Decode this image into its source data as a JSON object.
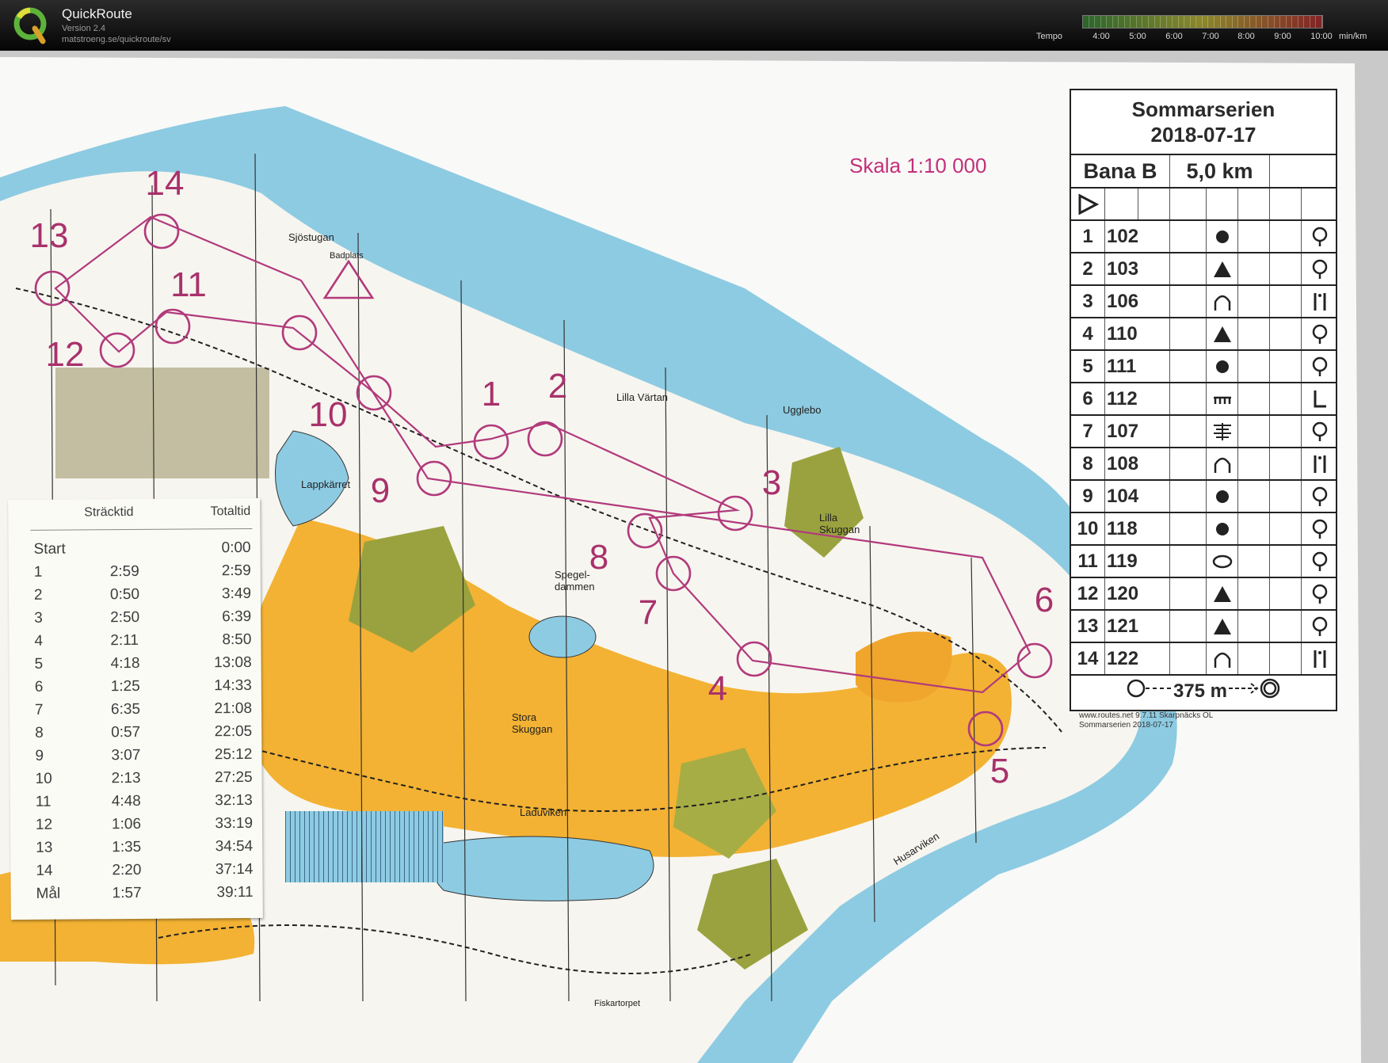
{
  "header": {
    "app_name": "QuickRoute",
    "version": "Version 2.4",
    "url": "matstroeng.se/quickroute/sv",
    "tempo_label": "Tempo",
    "tempo_ticks": [
      "4:00",
      "5:00",
      "6:00",
      "7:00",
      "8:00",
      "9:00",
      "10:00"
    ],
    "tempo_unit": "min/km",
    "tempo_colors": [
      "#3fa43a",
      "#e9e23a",
      "#d92f2f"
    ]
  },
  "map": {
    "scale": "Skala 1:10 000",
    "places": [
      "Sjöstugan",
      "Badplats",
      "Lilla Värtan",
      "Ugglebo",
      "Lappkärret",
      "Lilla Skuggan",
      "Spegel-dammen",
      "Stora Skuggan",
      "Laduviken",
      "Husarviken",
      "Fiskartorpet"
    ],
    "control_numbers": [
      "1",
      "2",
      "3",
      "4",
      "5",
      "6",
      "7",
      "8",
      "9",
      "10",
      "11",
      "12",
      "13",
      "14"
    ],
    "colors": {
      "water": "#86c9e0",
      "forest": "#f8f6f2",
      "open": "#f3b233",
      "green": "#9aa23f",
      "course": "#b13a7c"
    }
  },
  "splits": {
    "headers": {
      "leg": "Sträcktid",
      "total": "Totaltid"
    },
    "rows": [
      {
        "label": "Start",
        "leg": "",
        "total": "0:00"
      },
      {
        "label": "1",
        "leg": "2:59",
        "total": "2:59"
      },
      {
        "label": "2",
        "leg": "0:50",
        "total": "3:49"
      },
      {
        "label": "3",
        "leg": "2:50",
        "total": "6:39"
      },
      {
        "label": "4",
        "leg": "2:11",
        "total": "8:50"
      },
      {
        "label": "5",
        "leg": "4:18",
        "total": "13:08"
      },
      {
        "label": "6",
        "leg": "1:25",
        "total": "14:33"
      },
      {
        "label": "7",
        "leg": "6:35",
        "total": "21:08"
      },
      {
        "label": "8",
        "leg": "0:57",
        "total": "22:05"
      },
      {
        "label": "9",
        "leg": "3:07",
        "total": "25:12"
      },
      {
        "label": "10",
        "leg": "2:13",
        "total": "27:25"
      },
      {
        "label": "11",
        "leg": "4:48",
        "total": "32:13"
      },
      {
        "label": "12",
        "leg": "1:06",
        "total": "33:19"
      },
      {
        "label": "13",
        "leg": "1:35",
        "total": "34:54"
      },
      {
        "label": "14",
        "leg": "2:20",
        "total": "37:14"
      },
      {
        "label": "Mål",
        "leg": "1:57",
        "total": "39:11"
      }
    ]
  },
  "control_sheet": {
    "title_line1": "Sommarserien",
    "title_line2": "2018-07-17",
    "course": "Bana B",
    "length": "5,0 km",
    "controls": [
      {
        "num": "1",
        "code": "102",
        "feature": "dot-icon",
        "detail": "knoll-icon"
      },
      {
        "num": "2",
        "code": "103",
        "feature": "triangle-icon",
        "detail": "knoll-icon"
      },
      {
        "num": "3",
        "code": "106",
        "feature": "cliff-icon",
        "detail": "bar-icon"
      },
      {
        "num": "4",
        "code": "110",
        "feature": "triangle-icon",
        "detail": "knoll-icon"
      },
      {
        "num": "5",
        "code": "111",
        "feature": "dot-icon",
        "detail": "knoll-icon"
      },
      {
        "num": "6",
        "code": "112",
        "feature": "wall-icon",
        "detail": "corner-icon"
      },
      {
        "num": "7",
        "code": "107",
        "feature": "marsh-icon",
        "detail": "knoll-icon"
      },
      {
        "num": "8",
        "code": "108",
        "feature": "cliff-icon",
        "detail": "bar-icon"
      },
      {
        "num": "9",
        "code": "104",
        "feature": "dot-icon",
        "detail": "knoll-icon"
      },
      {
        "num": "10",
        "code": "118",
        "feature": "dot-icon",
        "detail": "knoll-icon"
      },
      {
        "num": "11",
        "code": "119",
        "feature": "oval-icon",
        "detail": "knoll-icon"
      },
      {
        "num": "12",
        "code": "120",
        "feature": "triangle-icon",
        "detail": "knoll-icon"
      },
      {
        "num": "13",
        "code": "121",
        "feature": "triangle-icon",
        "detail": "knoll-icon"
      },
      {
        "num": "14",
        "code": "122",
        "feature": "cliff-icon",
        "detail": "bar-icon"
      }
    ],
    "finish": "375 m",
    "credit_line1": "www.routes.net 9.7.11 Skarpnäcks OL",
    "credit_line2": "Sommarserien 2018-07-17"
  }
}
